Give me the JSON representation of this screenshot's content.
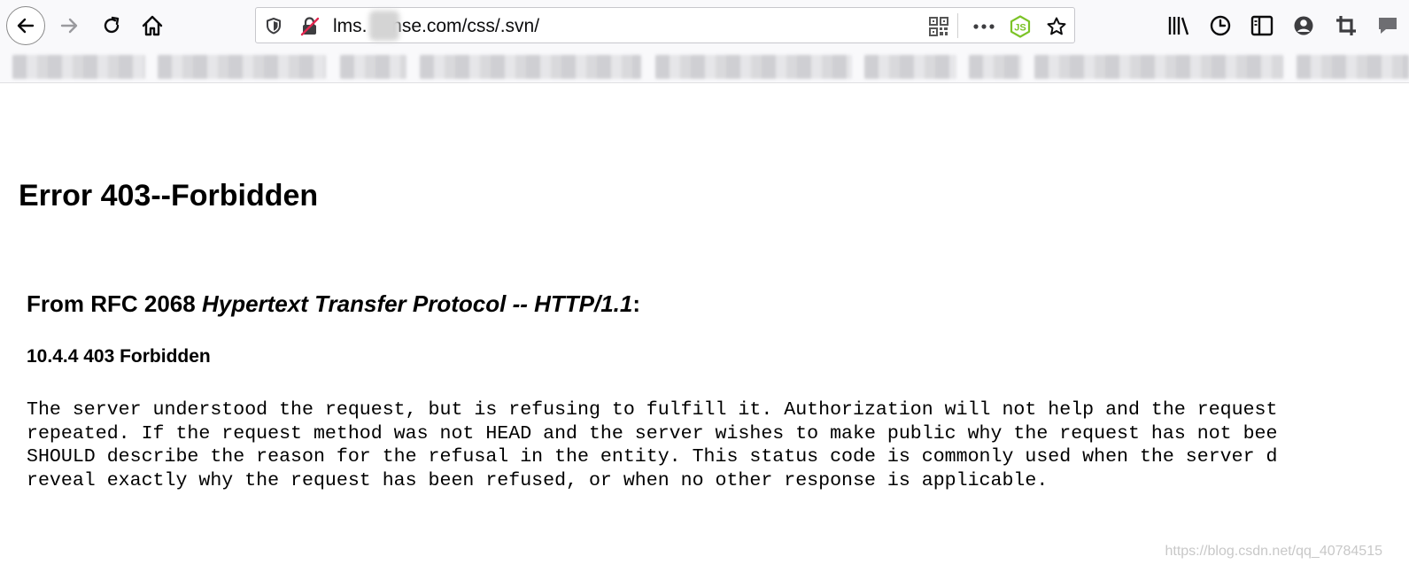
{
  "toolbar": {
    "back_icon": "arrow-left-icon",
    "forward_icon": "arrow-right-icon",
    "reload_icon": "reload-icon",
    "home_icon": "home-icon"
  },
  "urlbar": {
    "url_prefix": "lms.",
    "url_rest": "ense.com/css/.svn/",
    "icons": [
      "shield-icon",
      "insecure-lock-icon",
      "qr-code-icon",
      "more-icon",
      "nodejs-extension-icon",
      "bookmark-star-icon"
    ]
  },
  "right_icons": [
    "library-icon",
    "history-icon",
    "sidebar-icon",
    "account-icon",
    "crop-icon",
    "chat-icon"
  ],
  "page": {
    "title": "Error 403--Forbidden",
    "rfc_prefix": "From RFC 2068 ",
    "rfc_italic": "Hypertext Transfer Protocol -- HTTP/1.1",
    "rfc_suffix": ":",
    "section": "10.4.4 403 Forbidden",
    "description_lines": [
      "The server understood the request, but is refusing to fulfill it. Authorization will not help and the request",
      "repeated. If the request method was not HEAD and the server wishes to make public why the request has not bee",
      "SHOULD describe the reason for the refusal in the entity. This status code is commonly used when the server d",
      "reveal exactly why the request has been refused, or when no other response is applicable."
    ]
  },
  "watermark": "https://blog.csdn.net/qq_40784515",
  "colors": {
    "chrome_bg": "#f9f9fb",
    "urlbar_border": "#c7c7cc",
    "nodejs_green": "#7cc327",
    "insecure_red": "#e22850"
  }
}
